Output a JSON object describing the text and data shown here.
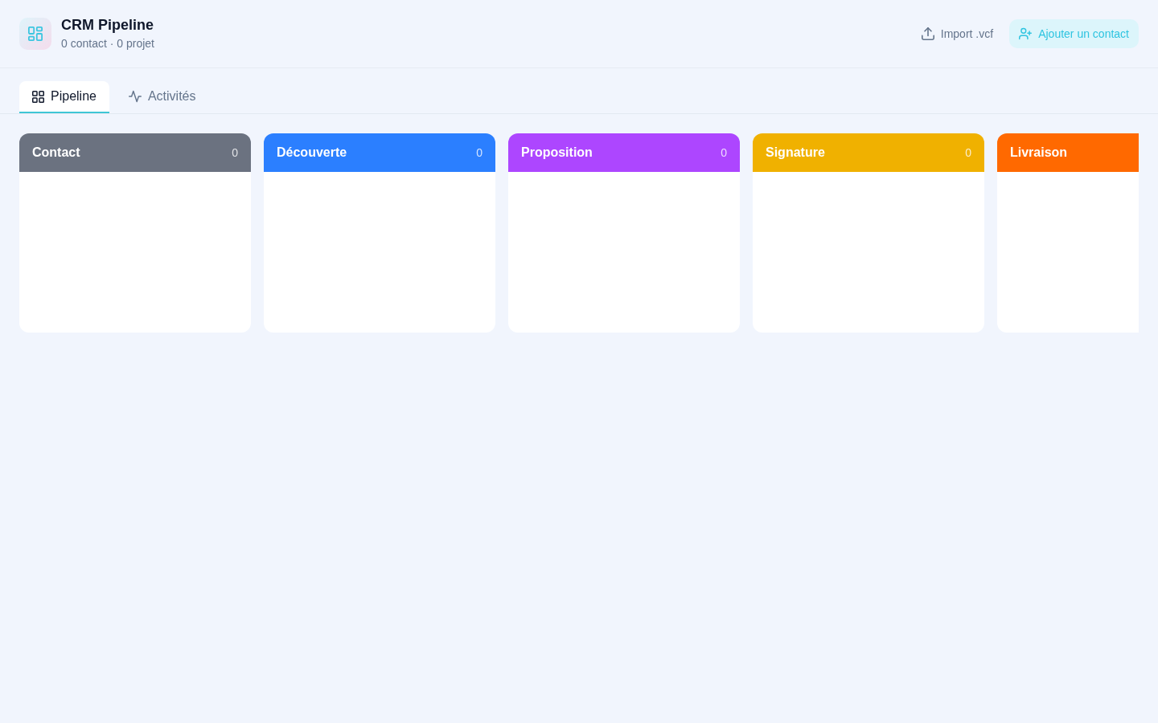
{
  "header": {
    "title": "CRM Pipeline",
    "subtitle": "0 contact · 0 projet"
  },
  "actions": [
    {
      "kind": "import",
      "label": "Import .vcf"
    },
    {
      "kind": "add",
      "label": "Ajouter un contact"
    }
  ],
  "tabs": [
    {
      "kind": "grid",
      "label": "Pipeline",
      "selected": true
    },
    {
      "kind": "activity",
      "label": "Activités",
      "selected": false
    }
  ],
  "columns": [
    {
      "name": "Contact",
      "count": "0",
      "color": "#6b7280"
    },
    {
      "name": "Découverte",
      "count": "0",
      "color": "#2b7fff"
    },
    {
      "name": "Proposition",
      "count": "0",
      "color": "#ad46ff"
    },
    {
      "name": "Signature",
      "count": "0",
      "color": "#f0b100"
    },
    {
      "name": "Livraison",
      "color": "#ff6900"
    }
  ]
}
